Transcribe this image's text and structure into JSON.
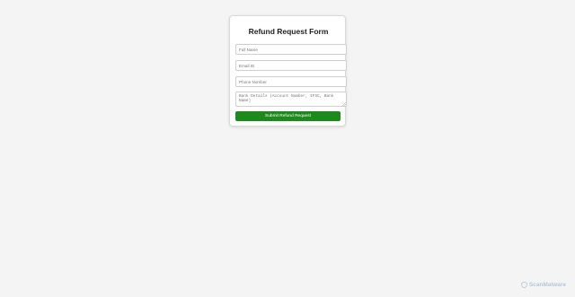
{
  "form": {
    "title": "Refund Request Form",
    "full_name_placeholder": "Full Name",
    "email_placeholder": "Email ID",
    "phone_placeholder": "Phone Number",
    "bank_placeholder": "Bank Details (Account Number, IFSC, Bank Name)",
    "submit_label": "Submit Refund Request"
  },
  "watermark": {
    "text": "ScanMalware",
    "icon": "shield-icon"
  },
  "colors": {
    "background": "#f4f4f4",
    "submit_button": "#1e8a1e",
    "watermark": "#b9c6d8"
  }
}
